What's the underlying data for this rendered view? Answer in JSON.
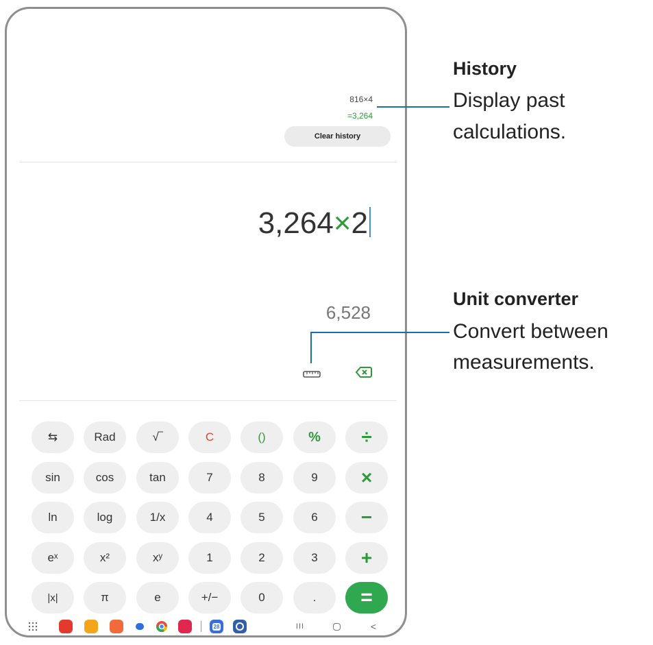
{
  "history": {
    "expression": "816×4",
    "result": "=3,264",
    "clear_label": "Clear history"
  },
  "display": {
    "operand1": "3,264",
    "operator": "×",
    "operand2": "2",
    "preview": "6,528"
  },
  "keys": [
    {
      "label": "⇆",
      "name": "toggle-keypad-icon",
      "style": ""
    },
    {
      "label": "Rad",
      "name": "key-rad",
      "style": ""
    },
    {
      "label": "√‾",
      "name": "key-sqrt",
      "style": ""
    },
    {
      "label": "C",
      "name": "key-clear",
      "style": "red"
    },
    {
      "label": "()",
      "name": "key-parentheses",
      "style": "green"
    },
    {
      "label": "%",
      "name": "key-percent",
      "style": "green pct"
    },
    {
      "label": "÷",
      "name": "key-divide",
      "style": "op"
    },
    {
      "label": "sin",
      "name": "key-sin",
      "style": ""
    },
    {
      "label": "cos",
      "name": "key-cos",
      "style": ""
    },
    {
      "label": "tan",
      "name": "key-tan",
      "style": ""
    },
    {
      "label": "7",
      "name": "key-7",
      "style": ""
    },
    {
      "label": "8",
      "name": "key-8",
      "style": ""
    },
    {
      "label": "9",
      "name": "key-9",
      "style": ""
    },
    {
      "label": "×",
      "name": "key-multiply",
      "style": "op"
    },
    {
      "label": "ln",
      "name": "key-ln",
      "style": ""
    },
    {
      "label": "log",
      "name": "key-log",
      "style": ""
    },
    {
      "label": "1/x",
      "name": "key-reciprocal",
      "style": ""
    },
    {
      "label": "4",
      "name": "key-4",
      "style": ""
    },
    {
      "label": "5",
      "name": "key-5",
      "style": ""
    },
    {
      "label": "6",
      "name": "key-6",
      "style": ""
    },
    {
      "label": "−",
      "name": "key-minus",
      "style": "op"
    },
    {
      "label": "eˣ",
      "name": "key-exp",
      "style": ""
    },
    {
      "label": "x²",
      "name": "key-square",
      "style": ""
    },
    {
      "label": "xʸ",
      "name": "key-power",
      "style": ""
    },
    {
      "label": "1",
      "name": "key-1",
      "style": ""
    },
    {
      "label": "2",
      "name": "key-2",
      "style": ""
    },
    {
      "label": "3",
      "name": "key-3",
      "style": ""
    },
    {
      "label": "+",
      "name": "key-plus",
      "style": "op"
    },
    {
      "label": "|x|",
      "name": "key-abs",
      "style": "small"
    },
    {
      "label": "π",
      "name": "key-pi",
      "style": ""
    },
    {
      "label": "e",
      "name": "key-e",
      "style": ""
    },
    {
      "label": "+/−",
      "name": "key-negate",
      "style": ""
    },
    {
      "label": "0",
      "name": "key-0",
      "style": ""
    },
    {
      "label": ".",
      "name": "key-decimal",
      "style": ""
    },
    {
      "label": "=",
      "name": "key-equals",
      "style": "equals"
    }
  ],
  "navbar": {
    "calendar_day": "28",
    "recents_glyph": "III",
    "back_glyph": "<"
  },
  "callouts": {
    "history_title": "History",
    "history_line1": "Display past",
    "history_line2": "calculations.",
    "unit_title": "Unit converter",
    "unit_line1": "Convert between",
    "unit_line2": "measurements."
  },
  "colors": {
    "accent_green": "#2e9a3c",
    "equals_green": "#2fa84f",
    "clear_red": "#e04638",
    "callout_line": "#1a6fa8"
  }
}
